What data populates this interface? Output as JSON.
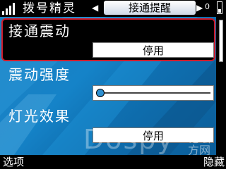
{
  "header": {
    "app_title": "拨号精灵",
    "tab_prev_arrow": "◀",
    "tab_active": "接通提醒",
    "tab_next_arrow": "▶",
    "battery_count": "0"
  },
  "settings": [
    {
      "label": "接通震动",
      "value": "停用"
    },
    {
      "label": "震动强度",
      "slider_level": 0.0
    },
    {
      "label": "灯光效果",
      "value": "停用"
    }
  ],
  "softkeys": {
    "left": "选项",
    "right": "隐藏"
  },
  "watermark": {
    "text": "Dospy",
    "cn": "论坛方网"
  },
  "icons": {
    "signal": "signal-bars-icon",
    "battery": "battery-icon"
  },
  "colors": {
    "selection_border": "#d01a2a",
    "background_blue": "#1583c8",
    "slider_thumb": "#2d8fd0"
  }
}
